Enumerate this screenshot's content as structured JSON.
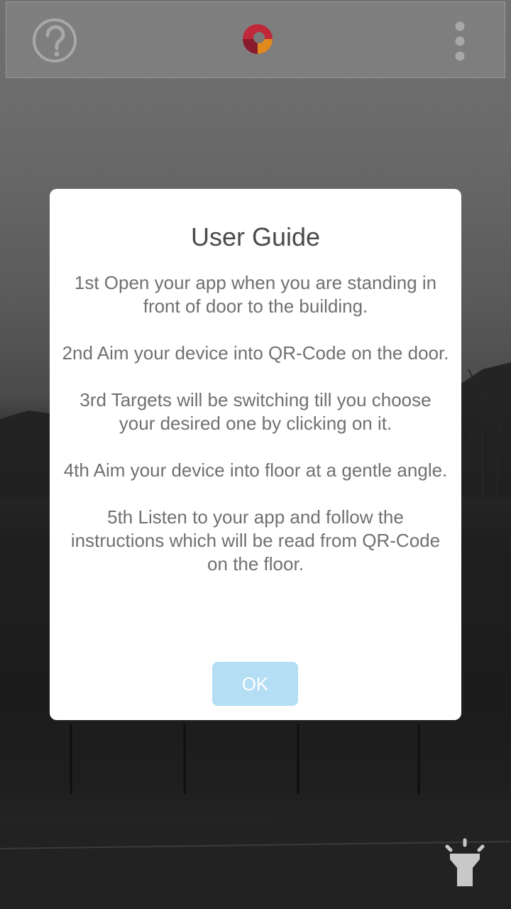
{
  "toolbar": {
    "help_icon": "question-circle-icon",
    "logo_icon": "app-logo",
    "more_icon": "more-vertical-icon"
  },
  "dialog": {
    "title": "User Guide",
    "steps": [
      "1st Open your app when you are standing in front of door to the building.",
      "2nd Aim your device into QR-Code on the door.",
      "3rd Targets will be switching till you choose your desired one by clicking on it.",
      "4th Aim your device into floor at a gentle angle.",
      "5th Listen to your app and follow the instructions which will be read from QR-Code on the floor."
    ],
    "ok_label": "OK"
  },
  "flashlight_icon": "flashlight-icon",
  "colors": {
    "ok_button": "#b3def3",
    "title_text": "#4a4a4a",
    "body_text": "#707070",
    "logo_red": "#c0283a",
    "logo_orange": "#e08a1e"
  }
}
